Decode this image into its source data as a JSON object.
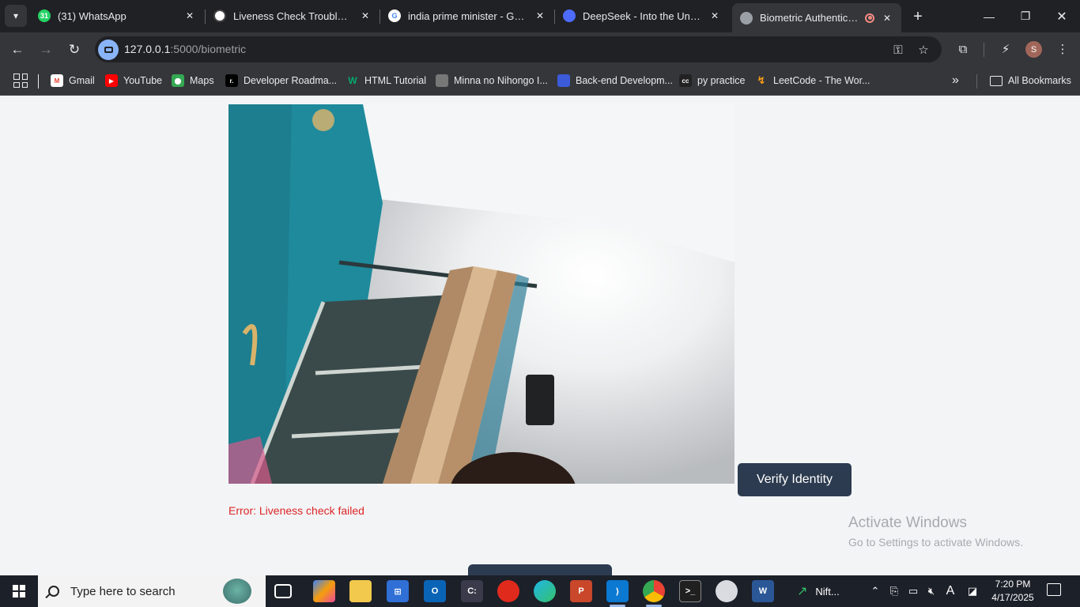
{
  "browser": {
    "tabs": [
      {
        "title": "(31) WhatsApp",
        "favicon": "whatsapp-icon",
        "color": "#25d366",
        "badge": "31"
      },
      {
        "title": "Liveness Check Troubleshoot",
        "favicon": "chatgpt-icon",
        "color": "#ffffff"
      },
      {
        "title": "india prime minister - Googl",
        "favicon": "google-icon",
        "color": "#4285f4"
      },
      {
        "title": "DeepSeek - Into the Unknow",
        "favicon": "deepseek-icon",
        "color": "#4d6bfe"
      },
      {
        "title": "Biometric Authenticatio",
        "favicon": "globe-icon",
        "color": "#9aa0a6",
        "active": true
      }
    ],
    "new_tab_glyph": "+",
    "url_host": "127.0.0.1",
    "url_path": ":5000/biometric",
    "profile_initial": "S"
  },
  "bookmarks": [
    {
      "label": "Gmail",
      "icon": "gmail-icon",
      "color": "#ea4335"
    },
    {
      "label": "YouTube",
      "icon": "youtube-icon",
      "color": "#ff0000"
    },
    {
      "label": "Maps",
      "icon": "maps-icon",
      "color": "#34a853"
    },
    {
      "label": "Developer Roadma...",
      "icon": "roadmap-icon",
      "color": "#000000"
    },
    {
      "label": "HTML Tutorial",
      "icon": "w3schools-icon",
      "color": "#04aa6d"
    },
    {
      "label": "Minna no Nihongo I...",
      "icon": "image-icon",
      "color": "#777777"
    },
    {
      "label": "Back-end Developm...",
      "icon": "course-icon",
      "color": "#3b5bdb"
    },
    {
      "label": "py practice",
      "icon": "cc-icon",
      "color": "#222222"
    },
    {
      "label": "LeetCode - The Wor...",
      "icon": "leetcode-icon",
      "color": "#ffa116"
    }
  ],
  "bookmarks_overflow": "»",
  "all_bookmarks_label": "All Bookmarks",
  "page": {
    "verify_button_label": "Verify Identity",
    "error_message": "Error: Liveness check failed"
  },
  "watermark": {
    "line1": "Activate Windows",
    "line2": "Go to Settings to activate Windows."
  },
  "taskbar": {
    "search_placeholder": "Type here to search",
    "nifty_label": "Nift...",
    "time": "7:20 PM",
    "date": "4/17/2025",
    "ime_label": "A"
  }
}
